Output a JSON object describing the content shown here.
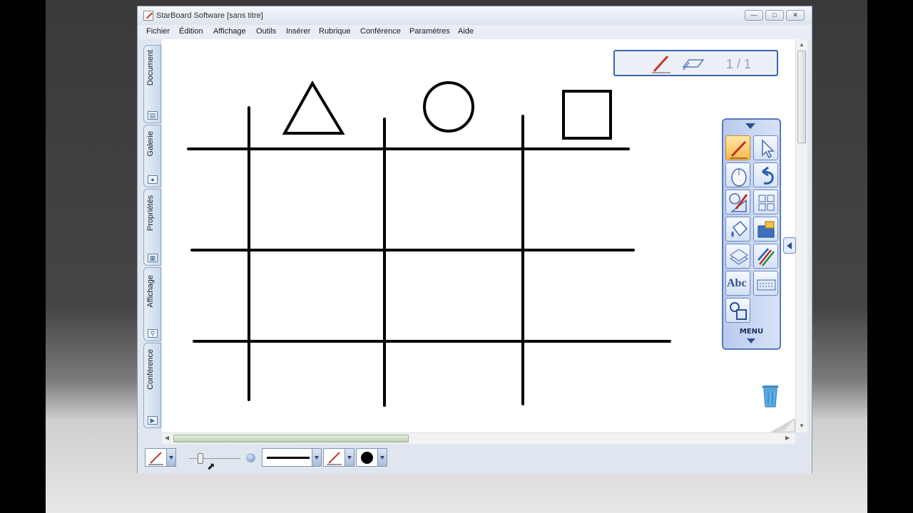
{
  "window": {
    "title": "StarBoard Software [sans titre]"
  },
  "menu": [
    "Fichier",
    "Édition",
    "Affichage",
    "Outils",
    "Insérer",
    "Rubrique",
    "Conférence",
    "Paramètres",
    "Aide"
  ],
  "side_tabs": [
    {
      "label": "Document",
      "icon": "document-icon"
    },
    {
      "label": "Galerie",
      "icon": "gallery-icon"
    },
    {
      "label": "Propriétés",
      "icon": "properties-icon"
    },
    {
      "label": "Affichage",
      "icon": "magnifier-icon"
    },
    {
      "label": "Conférence",
      "icon": "conference-icon"
    }
  ],
  "page_indicator": "1 / 1",
  "tool_panel": {
    "menu_label": "MENU",
    "tools": [
      "pen-icon",
      "pointer-icon",
      "mouse-icon",
      "undo-icon",
      "shape-pen-icon",
      "grid-icon",
      "bucket-icon",
      "photo-icon",
      "layers-icon",
      "pen-set-icon",
      "text-abc-icon",
      "keyboard-icon",
      "shapes-icon"
    ],
    "text_tool_label": "Abc"
  },
  "colors": {
    "accent": "#3d64b4",
    "active_tool": "#ffb84a",
    "drawing": "#000000"
  }
}
